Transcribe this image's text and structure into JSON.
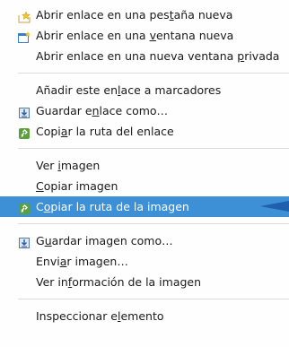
{
  "menu": {
    "items": [
      {
        "pre": "Abrir enlace en una pes",
        "acc": "t",
        "post": "aña nueva",
        "icon": "star-tab-icon"
      },
      {
        "pre": "Abrir enlace en una ",
        "acc": "v",
        "post": "entana nueva",
        "icon": "new-window-icon"
      },
      {
        "pre": "Abrir enlace en una nueva ventana ",
        "acc": "p",
        "post": "rivada",
        "icon": ""
      },
      {
        "pre": "Añadir este en",
        "acc": "l",
        "post": "ace a marcadores",
        "icon": ""
      },
      {
        "pre": "Guardar e",
        "acc": "n",
        "post": "lace como…",
        "icon": "save-download-icon"
      },
      {
        "pre": "Copi",
        "acc": "a",
        "post": "r la ruta del enlace",
        "icon": "copy-link-icon"
      },
      {
        "pre": "Ver ",
        "acc": "i",
        "post": "magen",
        "icon": ""
      },
      {
        "pre": "",
        "acc": "C",
        "post": "opiar imagen",
        "icon": ""
      },
      {
        "pre": "C",
        "acc": "o",
        "post": "piar la ruta de la imagen",
        "icon": "copy-link-icon"
      },
      {
        "pre": "G",
        "acc": "u",
        "post": "ardar imagen como…",
        "icon": "save-download-icon"
      },
      {
        "pre": "Envi",
        "acc": "a",
        "post": "r imagen…",
        "icon": ""
      },
      {
        "pre": "Ver in",
        "acc": "f",
        "post": "ormación de la imagen",
        "icon": ""
      },
      {
        "pre": "Inspeccionar e",
        "acc": "l",
        "post": "emento",
        "icon": ""
      }
    ]
  },
  "colors": {
    "highlight": "#3d8fd6",
    "pointer": "#1f5fae"
  }
}
